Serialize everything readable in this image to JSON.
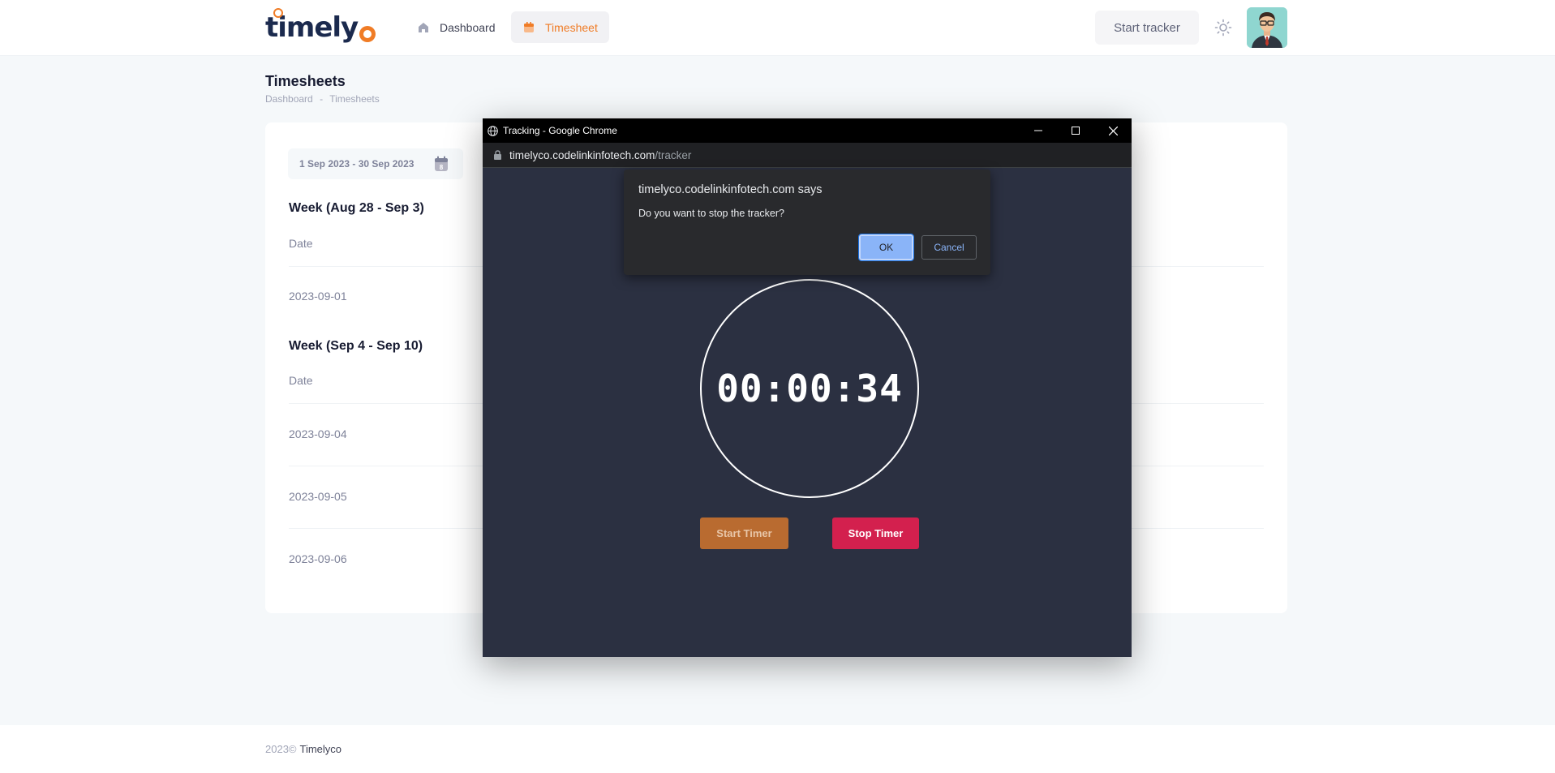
{
  "header": {
    "logo_text": "timely",
    "nav": [
      {
        "label": "Dashboard",
        "icon": "home-icon"
      },
      {
        "label": "Timesheet",
        "icon": "calendar-icon",
        "active": true
      }
    ],
    "start_tracker_label": "Start tracker",
    "theme_icon": "sun-icon"
  },
  "page": {
    "title": "Timesheets",
    "breadcrumb": [
      "Dashboard",
      "-",
      "Timesheets"
    ]
  },
  "timesheet": {
    "date_range": "1 Sep 2023 - 30 Sep 2023",
    "calendar_badge": "8",
    "weeks": [
      {
        "title": "Week (Aug 28 - Sep 3)",
        "column": "Date",
        "rows": [
          "2023-09-01"
        ]
      },
      {
        "title": "Week (Sep 4 - Sep 10)",
        "column": "Date",
        "rows": [
          "2023-09-04",
          "2023-09-05",
          "2023-09-06"
        ]
      }
    ]
  },
  "footer": {
    "year": "2023©",
    "brand": "Timelyco"
  },
  "popup": {
    "window_title": "Tracking - Google Chrome",
    "url_host": "timelyco.codelinkinfotech.com",
    "url_path": "/tracker",
    "timer": "00:00:34",
    "start_timer_label": "Start Timer",
    "stop_timer_label": "Stop Timer"
  },
  "alert": {
    "title": "timelyco.codelinkinfotech.com says",
    "message": "Do you want to stop the tracker?",
    "ok_label": "OK",
    "cancel_label": "Cancel"
  },
  "colors": {
    "accent": "#f07c26",
    "stop": "#d3204e",
    "popup_bg": "#2b3041"
  }
}
